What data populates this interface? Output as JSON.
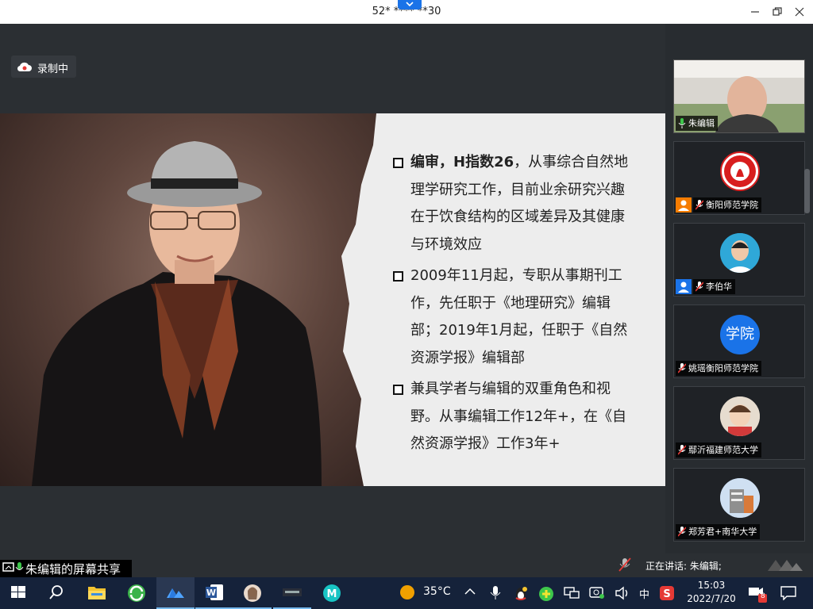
{
  "window": {
    "title": "52* **** **30"
  },
  "recording": {
    "label": "录制中"
  },
  "slide": {
    "bullets": [
      {
        "bold": "编审，H指数26",
        "rest": "，从事综合自然地理学研究工作，目前业余研究兴趣在于饮食结构的区域差异及其健康与环境效应"
      },
      {
        "bold": "",
        "rest": "2009年11月起，专职从事期刊工作，先任职于《地理研究》编辑部；2019年1月起，任职于《自然资源学报》编辑部"
      },
      {
        "bold": "",
        "rest": "兼具学者与编辑的双重角色和视野。从事编辑工作12年+，在《自然资源学报》工作3年+"
      }
    ]
  },
  "share_indicator": "朱编辑的屏幕共享",
  "speaking_status": "正在讲话: 朱编辑;",
  "participants": [
    {
      "name": "朱编辑",
      "avatar_text": "",
      "avatar_color": "#cccccc"
    },
    {
      "name": "衡阳师范学院",
      "avatar_text": "",
      "avatar_color": "#d81e1e"
    },
    {
      "name": "李伯华",
      "avatar_text": "",
      "avatar_color": "#2fa8d8"
    },
    {
      "name": "姚瑶衡阳师范学院",
      "avatar_text": "学院",
      "avatar_color": "#1a73e8"
    },
    {
      "name": "鄢沂福建师范大学",
      "avatar_text": "",
      "avatar_color": "#d8c7b5"
    },
    {
      "name": "郑芳君+南华大学",
      "avatar_text": "",
      "avatar_color": "#9fb4d4"
    }
  ],
  "taskbar": {
    "weather": "35°C",
    "ime": "中",
    "time": "15:03",
    "date": "2022/7/20",
    "notification_count": "8",
    "icons": [
      "windows-start-icon",
      "search-icon",
      "file-explorer-icon",
      "browser-icon",
      "tencent-meeting-icon",
      "word-icon",
      "photo-app-icon",
      "video-app-icon",
      "m-app-icon"
    ]
  },
  "colors": {
    "accent": "#1a73e8",
    "taskbar": "#15223a",
    "stage": "#2b2f33"
  }
}
